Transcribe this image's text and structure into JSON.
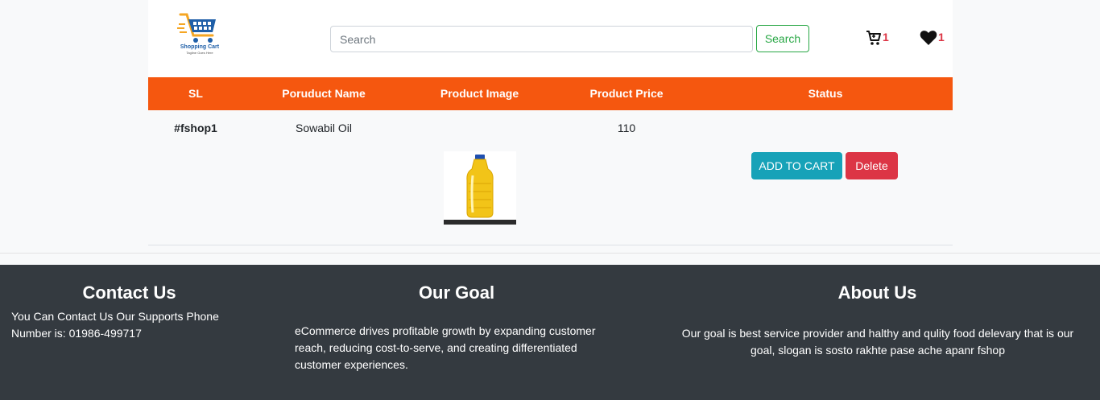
{
  "header": {
    "logo_text": "Shopping Cart",
    "logo_tagline": "Tagline Goes Here",
    "search_placeholder": "Search",
    "search_button": "Search",
    "cart_count": "1",
    "wishlist_count": "1"
  },
  "table": {
    "columns": [
      "SL",
      "Poruduct Name",
      "Product Image",
      "Product Price",
      "Status"
    ],
    "rows": [
      {
        "sl": "#fshop1",
        "name": "Sowabil Oil",
        "price": "110",
        "add_label": "ADD TO CART",
        "delete_label": "Delete"
      }
    ]
  },
  "footer": {
    "contact_title": "Contact Us",
    "contact_text": "You Can Contact Us Our Supports Phone Number is: 01986-499717",
    "goal_title": "Our Goal",
    "goal_text": "eCommerce drives profitable growth by expanding customer reach, reducing cost-to-serve, and creating differentiated customer experiences.",
    "about_title": "About Us",
    "about_text": "Our goal is best service provider and halthy and qulity food delevary that is our goal, slogan is sosto rakhte pase ache apanr fshop"
  },
  "colors": {
    "table_header": "#f5570f",
    "footer_bg": "#343a40",
    "add_button": "#17a2b8",
    "delete_button": "#dc3545",
    "search_button": "#28a745"
  },
  "icons": [
    "shopping-cart-logo-icon",
    "cart-icon",
    "heart-icon"
  ]
}
